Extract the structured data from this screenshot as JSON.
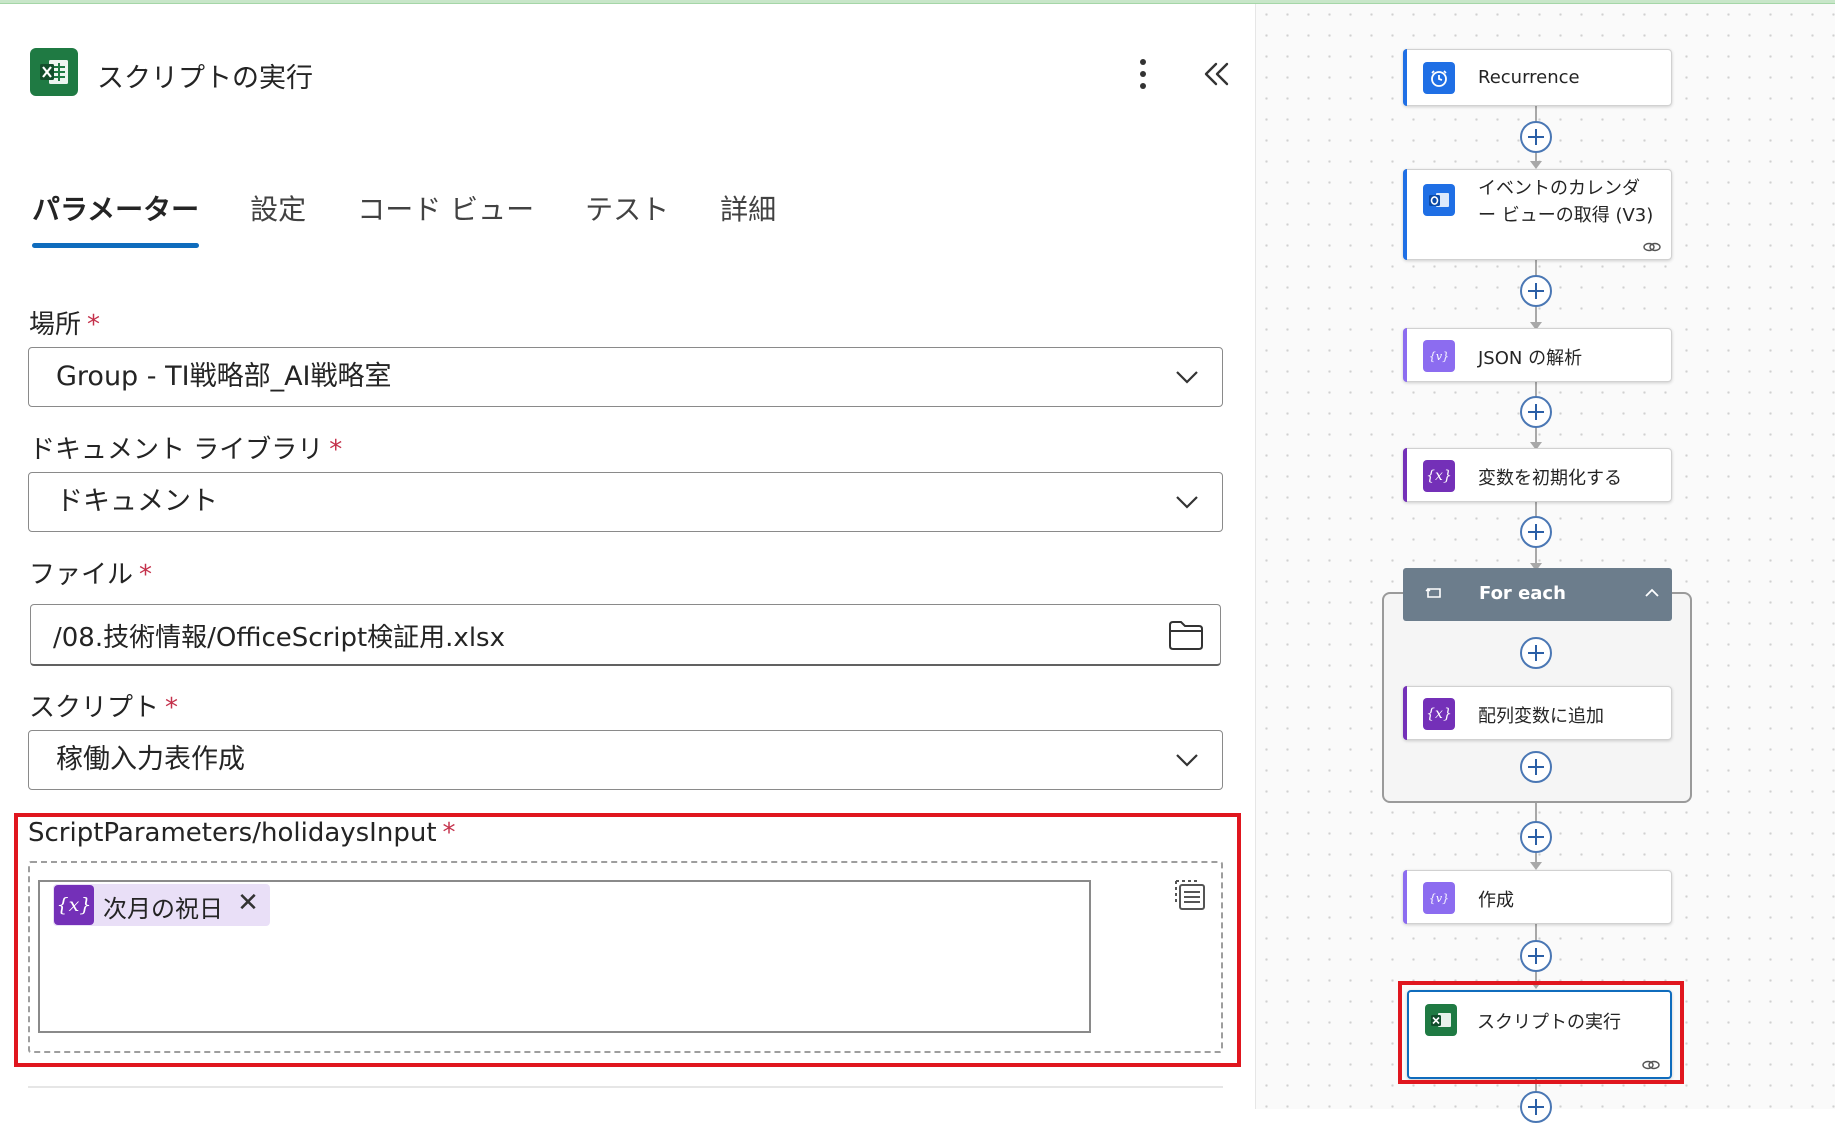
{
  "panel": {
    "title": "スクリプトの実行",
    "tabs": [
      "パラメーター",
      "設定",
      "コード ビュー",
      "テスト",
      "詳細"
    ],
    "active_tab": "パラメーター"
  },
  "fields": {
    "location": {
      "label": "場所",
      "required_mark": "*",
      "value": "Group - TI戦略部_AI戦略室"
    },
    "library": {
      "label": "ドキュメント ライブラリ",
      "required_mark": "*",
      "value": "ドキュメント"
    },
    "file": {
      "label": "ファイル",
      "required_mark": "*",
      "value": "/08.技術情報/OfficeScript検証用.xlsx"
    },
    "script": {
      "label": "スクリプト",
      "required_mark": "*",
      "value": "稼働入力表作成"
    },
    "script_param": {
      "label": "ScriptParameters/holidaysInput",
      "required_mark": "*",
      "token": {
        "icon_text": "{x}",
        "label": "次月の祝日",
        "close": "✕"
      }
    }
  },
  "flow": {
    "nodes": [
      {
        "label": "Recurrence",
        "icon": "clock-icon",
        "color": "#1f6fe5"
      },
      {
        "label_line1": "イベントのカレンダ",
        "label_line2": "ー ビューの取得 (V3)",
        "icon": "outlook-icon",
        "color": "#1f6fe5"
      },
      {
        "label": "JSON の解析",
        "icon": "data-operation-icon",
        "color": "#8c6cf0"
      },
      {
        "label": "変数を初期化する",
        "icon": "variable-icon",
        "icon_text": "{x}",
        "color": "#7430b8"
      },
      {
        "label": "For each",
        "icon": "loop-icon",
        "color": "#6c7d8c"
      },
      {
        "label": "配列変数に追加",
        "icon": "variable-icon",
        "icon_text": "{x}",
        "color": "#7430b8"
      },
      {
        "label": "作成",
        "icon": "data-operation-icon",
        "color": "#8c6cf0"
      },
      {
        "label": "スクリプトの実行",
        "icon": "excel-icon",
        "color": "#1f7a43"
      }
    ]
  },
  "colors": {
    "accent": "#0f6cbd",
    "highlight": "#e0161e",
    "required": "#c4314b"
  }
}
